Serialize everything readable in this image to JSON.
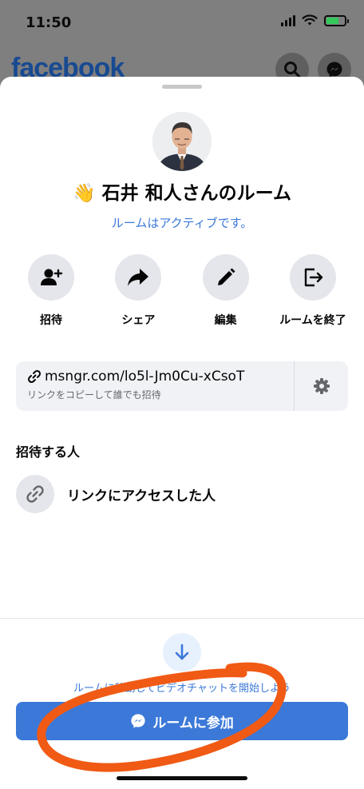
{
  "status_bar": {
    "time": "11:50"
  },
  "background_app": {
    "logo_text": "facebook"
  },
  "room": {
    "title": "石井 和人さんのルーム",
    "wave_emoji": "👋",
    "status": "ルームはアクティブです。"
  },
  "actions": [
    {
      "label": "招待",
      "icon": "add-person-icon"
    },
    {
      "label": "シェア",
      "icon": "share-arrow-icon"
    },
    {
      "label": "編集",
      "icon": "pencil-icon"
    },
    {
      "label": "ルームを終了",
      "icon": "exit-door-icon"
    }
  ],
  "link": {
    "url": "msngr.com/lo5l-Jm0Cu-xCsoT",
    "subtext": "リンクをコピーして誰でも招待"
  },
  "invite_section": {
    "title": "招待する人",
    "option_label": "リンクにアクセスした人"
  },
  "footer": {
    "move_text": "ルームに移動してビデオチャットを開始しよう",
    "join_label": "ルームに参加"
  },
  "colors": {
    "accent": "#3b78d8",
    "annotation": "#f05a14",
    "facebook_blue": "#184a91"
  }
}
